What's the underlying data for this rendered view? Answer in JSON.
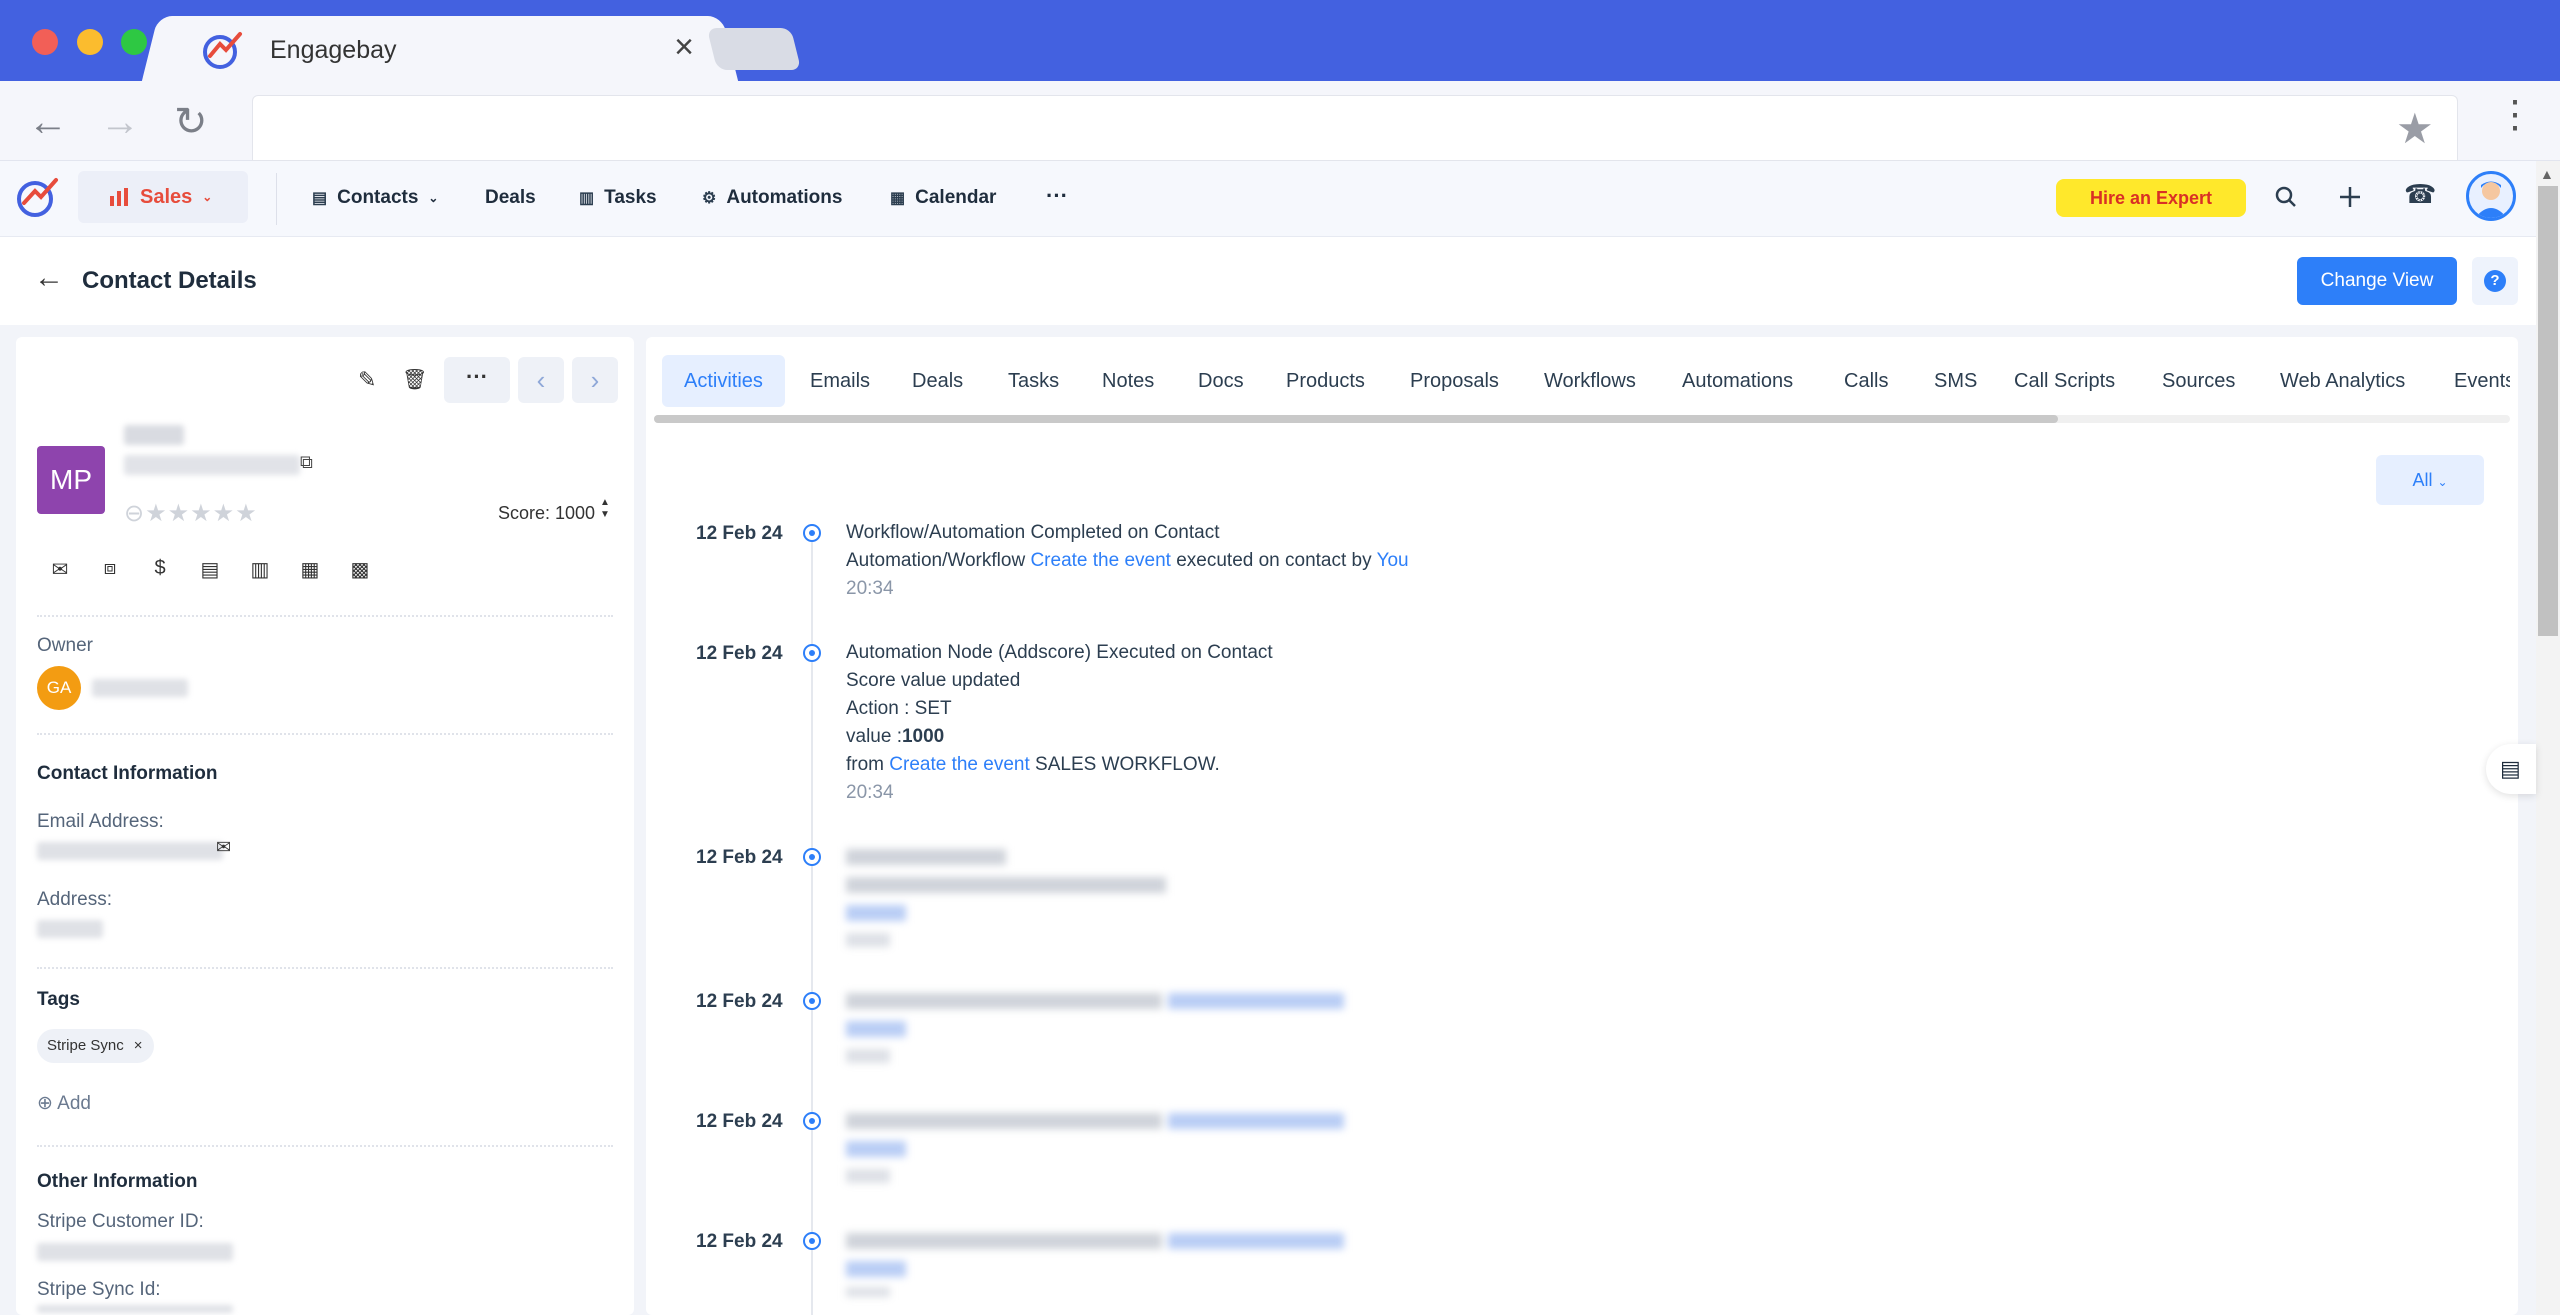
{
  "browser": {
    "tab_title": "Engagebay",
    "tab_close": "×",
    "back": "←",
    "forward": "→",
    "reload": "↻",
    "bookmark": "★",
    "menu": "⋮"
  },
  "topnav": {
    "module": "Sales",
    "items": [
      {
        "label": "Contacts",
        "icon": "contacts-icon"
      },
      {
        "label": "Deals",
        "icon": ""
      },
      {
        "label": "Tasks",
        "icon": "tasks-icon"
      },
      {
        "label": "Automations",
        "icon": "gear-icon"
      },
      {
        "label": "Calendar",
        "icon": "calendar-icon"
      }
    ],
    "more": "···",
    "hire_expert": "Hire an Expert"
  },
  "page": {
    "title": "Contact Details",
    "change_view": "Change View",
    "help": "?"
  },
  "contact": {
    "initials": "MP",
    "score_label": "Score: 1000",
    "owner_label": "Owner",
    "owner_initials": "GA",
    "contact_info_title": "Contact Information",
    "email_label": "Email Address:",
    "address_label": "Address:",
    "tags_title": "Tags",
    "tags": [
      "Stripe Sync"
    ],
    "add_tag": "Add",
    "other_info_title": "Other Information",
    "stripe_customer_label": "Stripe Customer ID:",
    "stripe_sync_label": "Stripe Sync Id:"
  },
  "tabs": [
    "Activities",
    "Emails",
    "Deals",
    "Tasks",
    "Notes",
    "Docs",
    "Products",
    "Proposals",
    "Workflows",
    "Automations",
    "Calls",
    "SMS",
    "Call Scripts",
    "Sources",
    "Web Analytics",
    "Events"
  ],
  "filter": "All",
  "activities": [
    {
      "date": "12 Feb 24",
      "line1": "Workflow/Automation Completed on Contact",
      "line2_pre": "Automation/Workflow ",
      "line2_link": "Create the event",
      "line2_mid": " executed on contact by ",
      "line2_link2": "You",
      "time": "20:34"
    },
    {
      "date": "12 Feb 24",
      "line1": "Automation Node (Addscore) Executed on Contact",
      "line2": "Score value updated",
      "line3": "Action : SET",
      "line4_pre": "value :",
      "line4_bold": "1000",
      "line5_pre": "from ",
      "line5_link": "Create the event",
      "line5_post": " SALES WORKFLOW.",
      "time": "20:34"
    },
    {
      "date": "12 Feb 24"
    },
    {
      "date": "12 Feb 24"
    },
    {
      "date": "12 Feb 24"
    },
    {
      "date": "12 Feb 24"
    }
  ]
}
